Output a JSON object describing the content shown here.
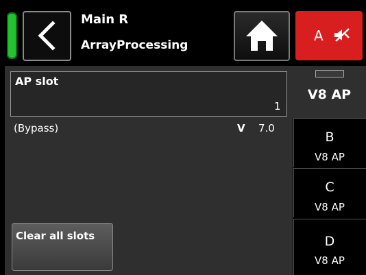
{
  "header": {
    "title_line1": "Main R",
    "title_line2": "ArrayProcessing",
    "mute_label": "A"
  },
  "status": {
    "color": "#22c32f"
  },
  "main": {
    "ap_slot_label": "AP slot",
    "ap_slot_value": "1",
    "bypass_text": "(Bypass)",
    "version_prefix": "V",
    "version_value": "7.0",
    "clear_button_label": "Clear all slots"
  },
  "tabs": [
    {
      "letter": "",
      "sub": "V8 AP",
      "active": true
    },
    {
      "letter": "B",
      "sub": "V8 AP",
      "active": false
    },
    {
      "letter": "C",
      "sub": "V8 AP",
      "active": false
    },
    {
      "letter": "D",
      "sub": "V8 AP",
      "active": false
    }
  ],
  "colors": {
    "mute_bg": "#d81e1e",
    "panel_bg": "#2f2f2f",
    "header_bg": "#000000"
  },
  "icons": {
    "back": "chevron-left-icon",
    "home": "home-icon",
    "mute": "speaker-muted-icon"
  }
}
